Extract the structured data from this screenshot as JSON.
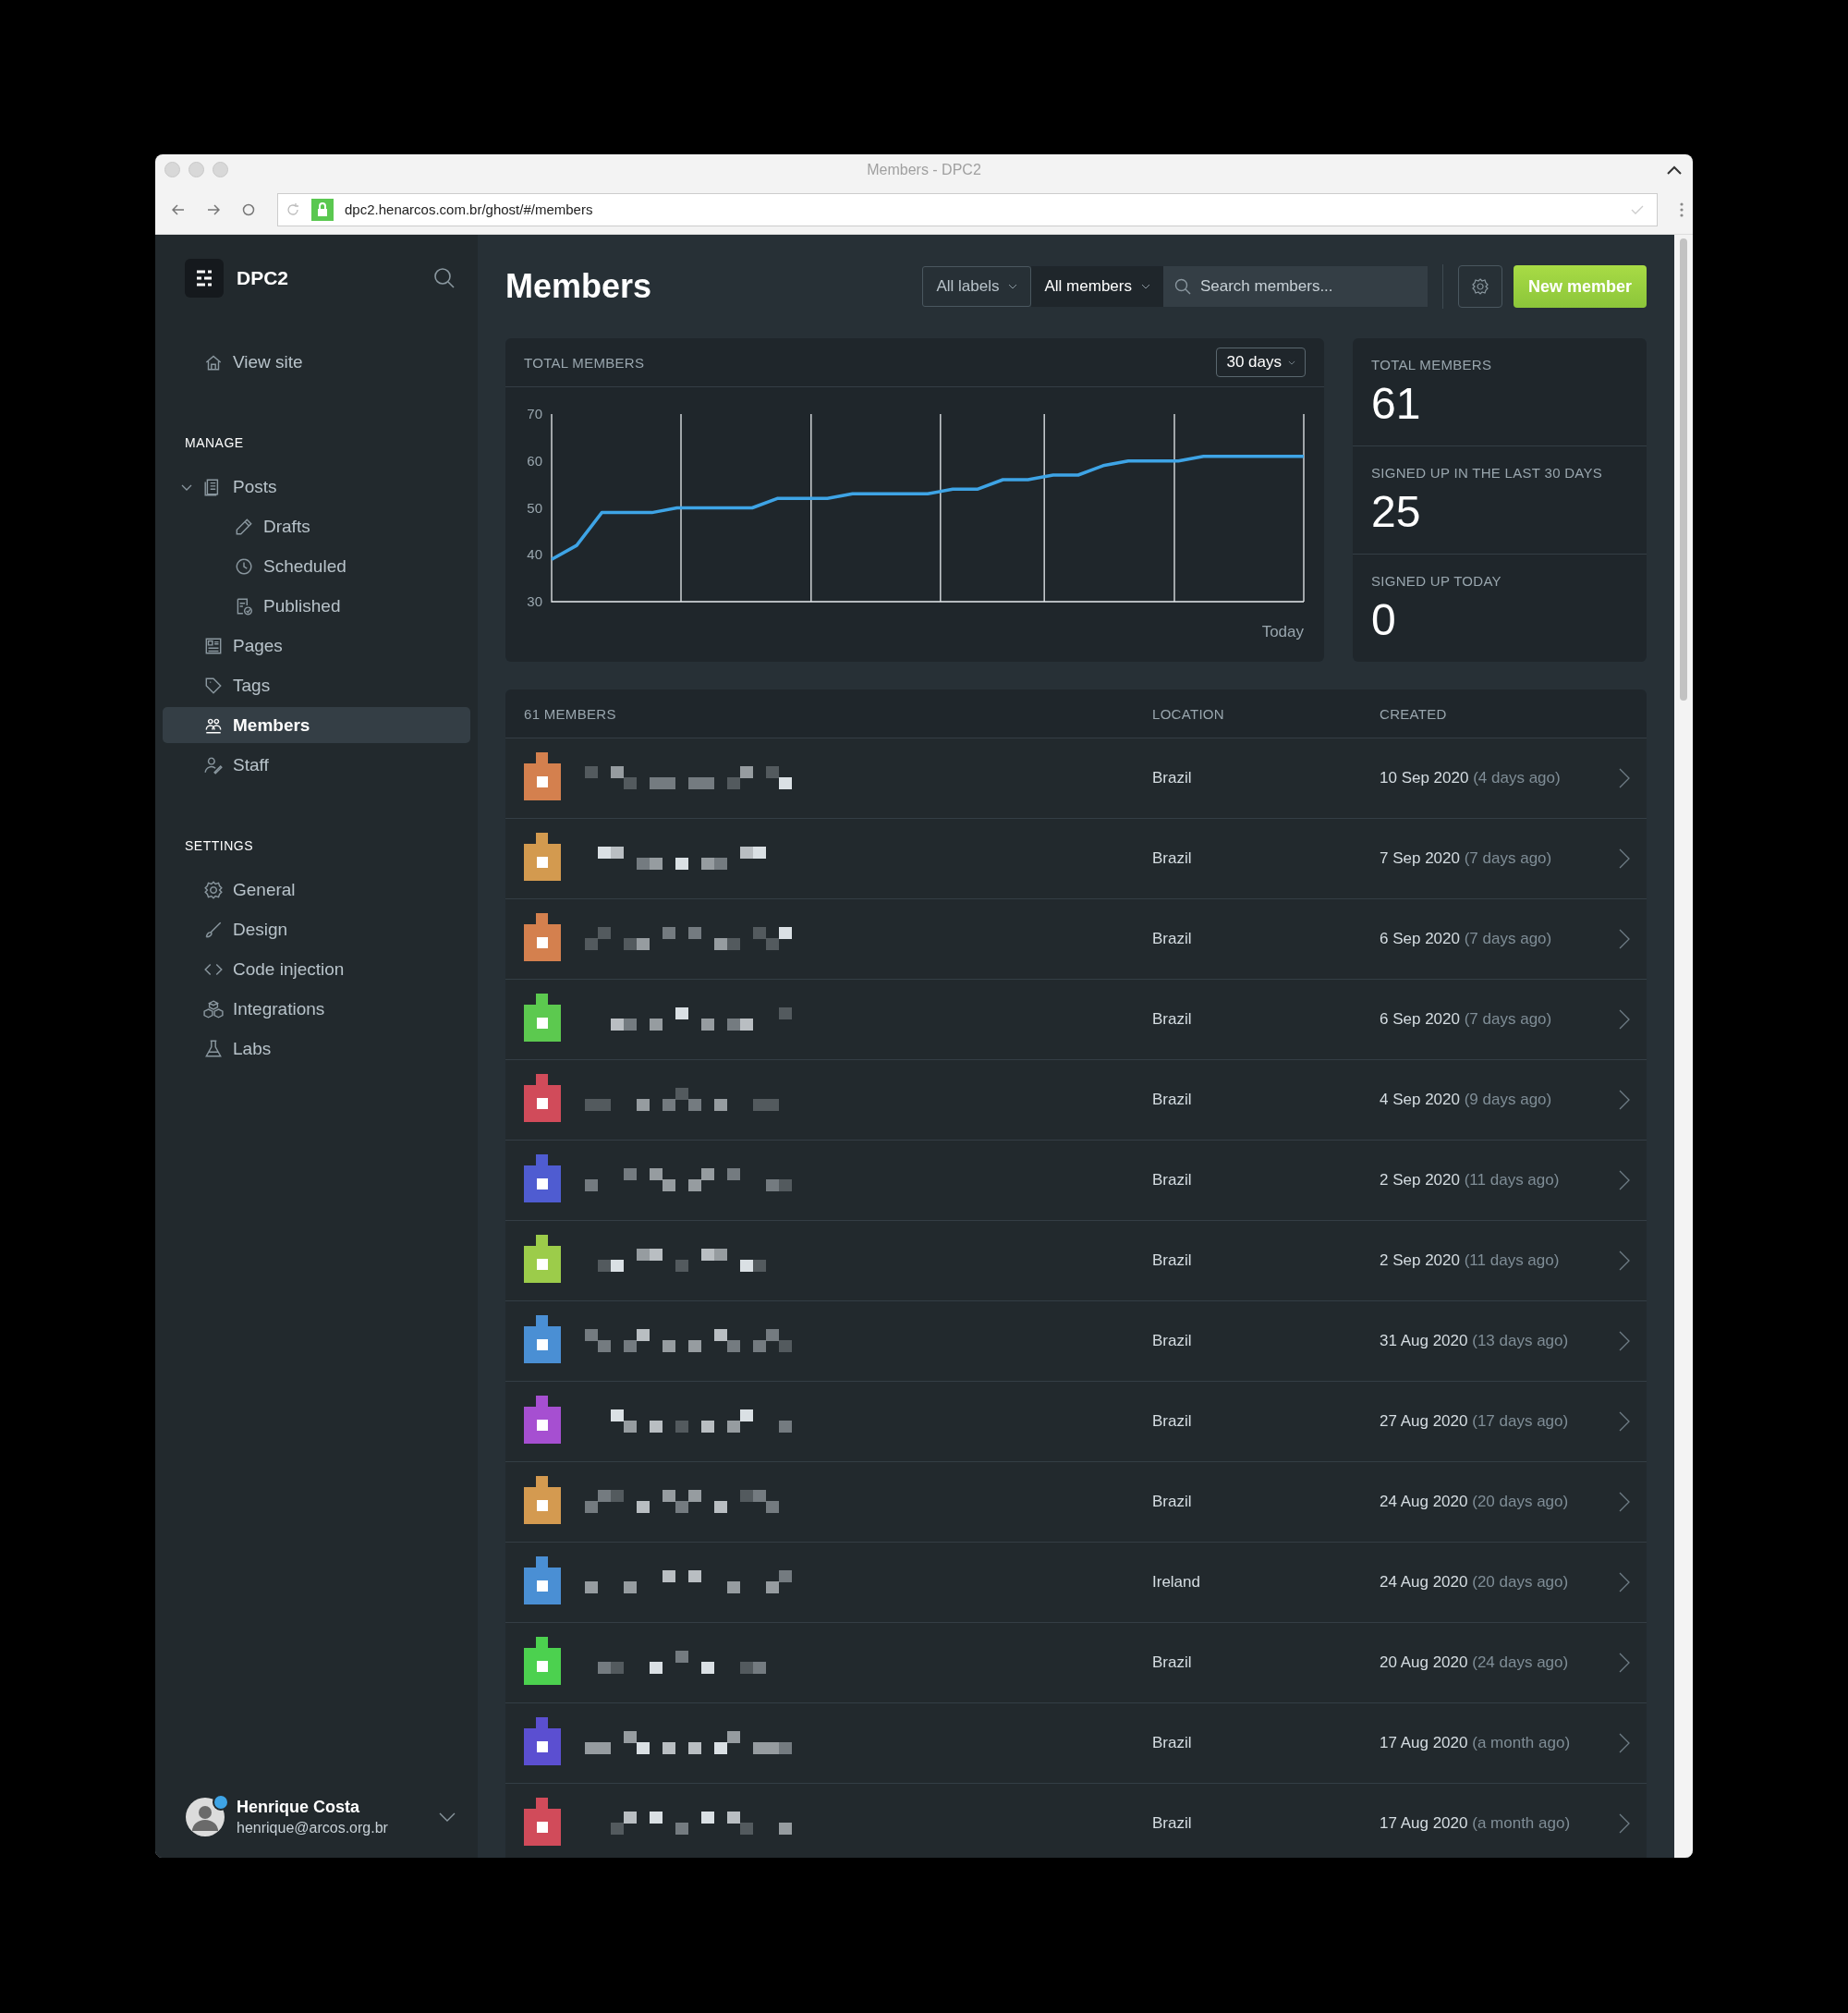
{
  "browser": {
    "title": "Members - DPC2",
    "url": "dpc2.henarcos.com.br/ghost/#/members"
  },
  "sidebar": {
    "brand": "DPC2",
    "view_site": "View site",
    "sections": [
      {
        "heading": "MANAGE",
        "items": [
          {
            "label": "Posts",
            "selected": false,
            "expanded": true,
            "children": [
              {
                "label": "Drafts",
                "selected": false
              },
              {
                "label": "Scheduled",
                "selected": false
              },
              {
                "label": "Published",
                "selected": false
              }
            ]
          },
          {
            "label": "Pages",
            "selected": false
          },
          {
            "label": "Tags",
            "selected": false
          },
          {
            "label": "Members",
            "selected": true
          },
          {
            "label": "Staff",
            "selected": false
          }
        ]
      },
      {
        "heading": "SETTINGS",
        "items": [
          {
            "label": "General",
            "selected": false
          },
          {
            "label": "Design",
            "selected": false
          },
          {
            "label": "Code injection",
            "selected": false
          },
          {
            "label": "Integrations",
            "selected": false
          },
          {
            "label": "Labs",
            "selected": false
          }
        ]
      }
    ],
    "user": {
      "name": "Henrique Costa",
      "email": "henrique@arcos.org.br"
    }
  },
  "header": {
    "title": "Members",
    "labels_filter": "All labels",
    "members_filter": "All members",
    "search": {
      "placeholder": "Search members..."
    },
    "new_button": "New member"
  },
  "chart_card": {
    "title": "TOTAL MEMBERS",
    "range": "30 days",
    "today_label": "Today",
    "chart_data": {
      "type": "line",
      "ylim": [
        30,
        70
      ],
      "yticks": [
        {
          "value": 30,
          "label": "30"
        },
        {
          "value": 40,
          "label": "40"
        },
        {
          "value": 50,
          "label": "50"
        },
        {
          "value": 60,
          "label": "60"
        },
        {
          "value": 70,
          "label": "70"
        }
      ],
      "series": [
        {
          "color": "#3ea4e6",
          "values": [
            39,
            42,
            49,
            49,
            49,
            50,
            50,
            50,
            50,
            52,
            52,
            52,
            53,
            53,
            53,
            53,
            54,
            54,
            56,
            56,
            57,
            57,
            59,
            60,
            60,
            60,
            61,
            61,
            61,
            61,
            61
          ]
        }
      ]
    }
  },
  "stats": [
    {
      "label": "TOTAL MEMBERS",
      "value": "61"
    },
    {
      "label": "SIGNED UP IN THE LAST 30 DAYS",
      "value": "25"
    },
    {
      "label": "SIGNED UP TODAY",
      "value": "0"
    }
  ],
  "table": {
    "columns": [
      "61 MEMBERS",
      "LOCATION",
      "CREATED"
    ],
    "rows": [
      {
        "color": "#d4804e",
        "location": "Brazil",
        "date": "10 Sep 2020",
        "ago": "(4 days ago)"
      },
      {
        "color": "#d39a4f",
        "location": "Brazil",
        "date": "7 Sep 2020",
        "ago": "(7 days ago)"
      },
      {
        "color": "#d4804e",
        "location": "Brazil",
        "date": "6 Sep 2020",
        "ago": "(7 days ago)"
      },
      {
        "color": "#5cc94f",
        "location": "Brazil",
        "date": "6 Sep 2020",
        "ago": "(7 days ago)"
      },
      {
        "color": "#d14b5a",
        "location": "Brazil",
        "date": "4 Sep 2020",
        "ago": "(9 days ago)"
      },
      {
        "color": "#4f5cd1",
        "location": "Brazil",
        "date": "2 Sep 2020",
        "ago": "(11 days ago)"
      },
      {
        "color": "#9ccc4a",
        "location": "Brazil",
        "date": "2 Sep 2020",
        "ago": "(11 days ago)"
      },
      {
        "color": "#4a8fd4",
        "location": "Brazil",
        "date": "31 Aug 2020",
        "ago": "(13 days ago)"
      },
      {
        "color": "#a64fd1",
        "location": "Brazil",
        "date": "27 Aug 2020",
        "ago": "(17 days ago)"
      },
      {
        "color": "#d49a50",
        "location": "Brazil",
        "date": "24 Aug 2020",
        "ago": "(20 days ago)"
      },
      {
        "color": "#4a8fd4",
        "location": "Ireland",
        "date": "24 Aug 2020",
        "ago": "(20 days ago)"
      },
      {
        "color": "#4cd14f",
        "location": "Brazil",
        "date": "20 Aug 2020",
        "ago": "(24 days ago)"
      },
      {
        "color": "#5b4fd1",
        "location": "Brazil",
        "date": "17 Aug 2020",
        "ago": "(a month ago)"
      },
      {
        "color": "#d14b5a",
        "location": "Brazil",
        "date": "17 Aug 2020",
        "ago": "(a month ago)"
      }
    ]
  }
}
